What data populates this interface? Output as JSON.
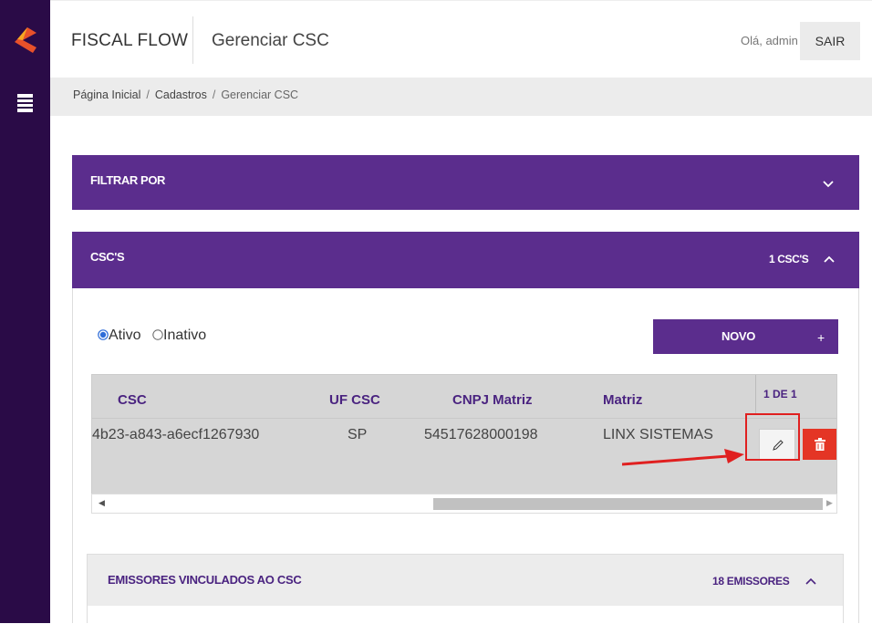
{
  "header": {
    "brand": "FISCAL FLOW",
    "page_title": "Gerenciar CSC",
    "greeting": "Olá, admin",
    "logout_label": "SAIR"
  },
  "breadcrumb": {
    "items": [
      "Página Inicial",
      "Cadastros",
      "Gerenciar CSC"
    ],
    "separator": "/"
  },
  "filter_panel": {
    "title": "FILTRAR POR"
  },
  "csc_panel": {
    "title": "CSC'S",
    "count_label": "1 CSC'S",
    "radio_options": [
      "Ativo",
      "Inativo"
    ],
    "selected_radio": "Ativo",
    "new_button_label": "NOVO",
    "new_button_icon": "+",
    "table": {
      "columns": [
        "CSC",
        "UF CSC",
        "CNPJ Matriz",
        "Matriz"
      ],
      "page_info": "1 DE 1",
      "rows": [
        {
          "csc": "4b23-a843-a6ecf1267930",
          "uf": "SP",
          "cnpj": "54517628000198",
          "matriz": "LINX SISTEMAS"
        }
      ]
    }
  },
  "emissores_panel": {
    "title": "EMISSORES VINCULADOS AO CSC",
    "count_label": "18 EMISSORES"
  },
  "colors": {
    "sidebar": "#2a0b47",
    "accent_purple": "#5b2d8d",
    "header_text_purple": "#4a2380",
    "delete_red": "#e43525",
    "annotation_red": "#e02020"
  },
  "icons": {
    "logo": "fiscal-flow-logo-icon",
    "menu": "stacked-menu-icon",
    "chevron_down": "chevron-down-icon",
    "chevron_up": "chevron-up-icon",
    "edit": "pencil-icon",
    "delete": "trash-icon"
  }
}
